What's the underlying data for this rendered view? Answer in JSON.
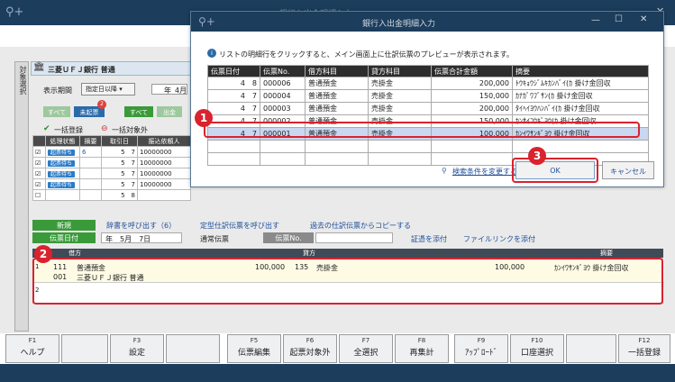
{
  "main_title": "銀行入出金明細入力",
  "side_tab": "対象選択",
  "bank_header": "三菱ＵＦＪ銀行 普通",
  "period_label": "表示期間",
  "period_select": "指定日以降",
  "year_label": "年",
  "month_label": "4月",
  "filter_buttons": {
    "all1": "すべて",
    "unregistered": "未起票",
    "all2": "すべて",
    "out": "出金",
    "unreg_count": "2"
  },
  "bulk_register": "一括登録",
  "bulk_exclude": "一括対象外",
  "left_grid": {
    "headers": [
      "",
      "処理状態",
      "摘要",
      "取引日",
      "振込依頼人"
    ],
    "rows": [
      {
        "status": "起票待ち",
        "tekiyo": "6",
        "m": "5",
        "d": "7",
        "payer": "10000000"
      },
      {
        "status": "起票待ち",
        "tekiyo": "",
        "m": "5",
        "d": "7",
        "payer": "10000000"
      },
      {
        "status": "起票待ち",
        "tekiyo": "",
        "m": "5",
        "d": "7",
        "payer": "10000000"
      },
      {
        "status": "起票待ち",
        "tekiyo": "",
        "m": "5",
        "d": "7",
        "payer": "10000000"
      },
      {
        "status": "",
        "tekiyo": "",
        "m": "5",
        "d": "8",
        "payer": ""
      }
    ]
  },
  "dialog": {
    "title": "銀行入出金明細入力",
    "info": "リストの明細行をクリックすると、メイン画面上に仕訳伝票のプレビューが表示されます。",
    "headers": [
      "伝票日付",
      "伝票No.",
      "借方科目",
      "貸方科目",
      "伝票合計金額",
      "摘要"
    ],
    "rows": [
      {
        "m": "4",
        "d": "8",
        "no": "000006",
        "debit": "普通預金",
        "credit": "売掛金",
        "amount": "200,000",
        "memo": "ﾄｳｷｮｳｼﾞﾑｷｶﾝﾊﾞｲ(ｶ 掛け金回収"
      },
      {
        "m": "4",
        "d": "7",
        "no": "000004",
        "debit": "普通預金",
        "credit": "売掛金",
        "amount": "150,000",
        "memo": "ｶﾅｶﾞﾜﾌﾞｻﾝ(ｶ 掛け金回収"
      },
      {
        "m": "4",
        "d": "7",
        "no": "000003",
        "debit": "普通預金",
        "credit": "売掛金",
        "amount": "200,000",
        "memo": "ﾀｲﾍｲﾖｳﾊﾝﾊﾞｲ(ｶ 掛け金回収"
      },
      {
        "m": "4",
        "d": "7",
        "no": "000002",
        "debit": "普通預金",
        "credit": "売掛金",
        "amount": "150,000",
        "memo": "ｶﾝｻｲｺｳｷﾞﾖｳ(ｶ 掛け金回収"
      },
      {
        "m": "4",
        "d": "7",
        "no": "000001",
        "debit": "普通預金",
        "credit": "売掛金",
        "amount": "100,000",
        "memo": "ｶﾝｲﾜｻﾝｷﾞﾖｳ 掛け金回収"
      }
    ],
    "search_link": "検索条件を変更する",
    "ok": "OK",
    "cancel": "キャンセル"
  },
  "callouts": [
    "1",
    "2",
    "3"
  ],
  "entry": {
    "new_label": "新規",
    "dict_link": "辞書を呼び出す（6）",
    "fixed_link": "定型仕訳伝票を呼び出す",
    "copy_link": "過去の仕訳伝票からコピーする",
    "date_label": "伝票日付",
    "date_value": "年　5月　7日",
    "normal_label": "通常伝票",
    "slipno_label": "伝票No.",
    "attach_label": "証憑を添付",
    "filelink_label": "ファイルリンクを添付",
    "debit_hdr": "借方",
    "credit_hdr": "貸方",
    "memo_hdr": "摘要",
    "row1": {
      "code1": "111",
      "acct1": "普通預金",
      "code2": "001",
      "sub1": "三菱ＵＦＪ銀行 普通",
      "amount1": "100,000",
      "code3": "135",
      "acct2": "売掛金",
      "amount2": "100,000",
      "memo": "ｶﾝｲﾜｻﾝｷﾞﾖｳ 掛け金回収"
    },
    "row_nums": [
      "1",
      "2"
    ]
  },
  "fkeys": [
    {
      "k": "F1",
      "n": "ヘルプ"
    },
    {
      "k": "",
      "n": ""
    },
    {
      "k": "F3",
      "n": "設定"
    },
    {
      "k": "",
      "n": ""
    },
    {
      "k": "F5",
      "n": "伝票編集"
    },
    {
      "k": "F6",
      "n": "起票対象外"
    },
    {
      "k": "F7",
      "n": "全選択"
    },
    {
      "k": "F8",
      "n": "再集計"
    },
    {
      "k": "F9",
      "n": "ｱｯﾌﾟﾛｰﾄﾞ"
    },
    {
      "k": "F10",
      "n": "口座選択"
    },
    {
      "k": "",
      "n": ""
    },
    {
      "k": "F12",
      "n": "一括登録"
    }
  ]
}
